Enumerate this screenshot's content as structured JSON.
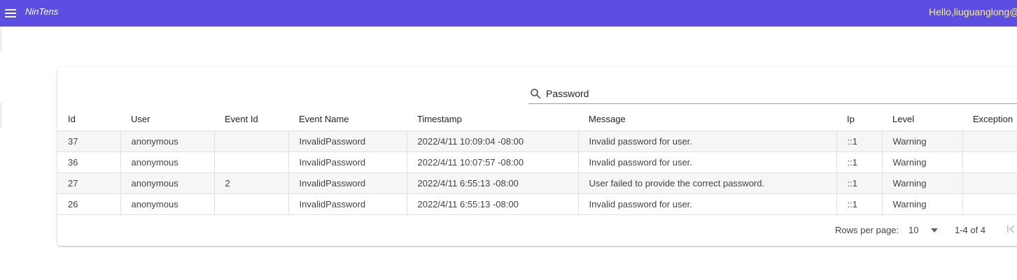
{
  "app": {
    "title": "NinTens",
    "greeting": "Hello,liuguanglong@"
  },
  "colors": {
    "appbar": "#5b4ee0",
    "greeting": "#fff176"
  },
  "icons": {
    "menu": "menu-icon",
    "search": "search-icon",
    "dropdown": "chevron-down-icon",
    "first_page": "first-page-icon"
  },
  "search": {
    "value": "Password"
  },
  "table": {
    "columns": [
      "Id",
      "User",
      "Event Id",
      "Event Name",
      "Timestamp",
      "Message",
      "Ip",
      "Level",
      "Exception"
    ],
    "rows": [
      [
        "37",
        "anonymous",
        "",
        "InvalidPassword",
        "2022/4/11 10:09:04 -08:00",
        "Invalid password for user.",
        "::1",
        "Warning",
        ""
      ],
      [
        "36",
        "anonymous",
        "",
        "InvalidPassword",
        "2022/4/11 10:07:57 -08:00",
        "Invalid password for user.",
        "::1",
        "Warning",
        ""
      ],
      [
        "27",
        "anonymous",
        "2",
        "InvalidPassword",
        "2022/4/11 6:55:13 -08:00",
        "User failed to provide the correct password.",
        "::1",
        "Warning",
        ""
      ],
      [
        "26",
        "anonymous",
        "",
        "InvalidPassword",
        "2022/4/11 6:55:13 -08:00",
        "Invalid password for user.",
        "::1",
        "Warning",
        ""
      ]
    ]
  },
  "pagination": {
    "rows_per_page_label": "Rows per page:",
    "rows_per_page": "10",
    "range": "1-4 of 4"
  }
}
